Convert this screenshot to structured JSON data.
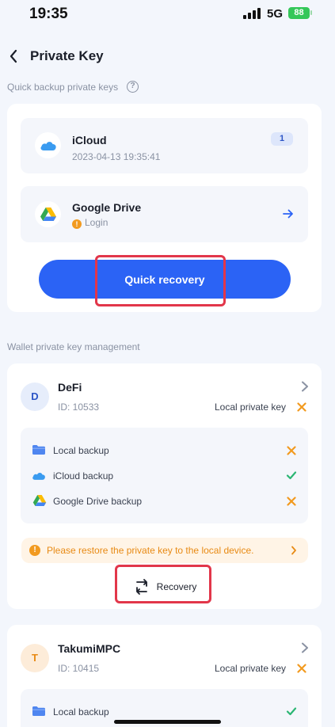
{
  "status_bar": {
    "time": "19:35",
    "network": "5G",
    "battery": "88"
  },
  "header": {
    "title": "Private Key"
  },
  "quick_backup": {
    "label": "Quick backup private keys",
    "icloud": {
      "name": "iCloud",
      "timestamp": "2023-04-13 19:35:41",
      "count": "1"
    },
    "google_drive": {
      "name": "Google Drive",
      "status": "Login"
    },
    "button": "Quick recovery"
  },
  "management": {
    "label": "Wallet private key management",
    "wallets": [
      {
        "initial": "D",
        "name": "DeFi",
        "id": "ID: 10533",
        "local_key": "Local private key",
        "rows": [
          "Local backup",
          "iCloud backup",
          "Google Drive backup"
        ],
        "notice": "Please restore the private key to the local device.",
        "recovery_label": "Recovery"
      },
      {
        "initial": "T",
        "name": "TakumiMPC",
        "id": "ID: 10415",
        "local_key": "Local private key",
        "rows": [
          "Local backup"
        ]
      }
    ]
  },
  "colors": {
    "primary": "#2b63f5",
    "warning": "#f29a1f",
    "success": "#2bb673",
    "highlight": "#e2364a"
  }
}
